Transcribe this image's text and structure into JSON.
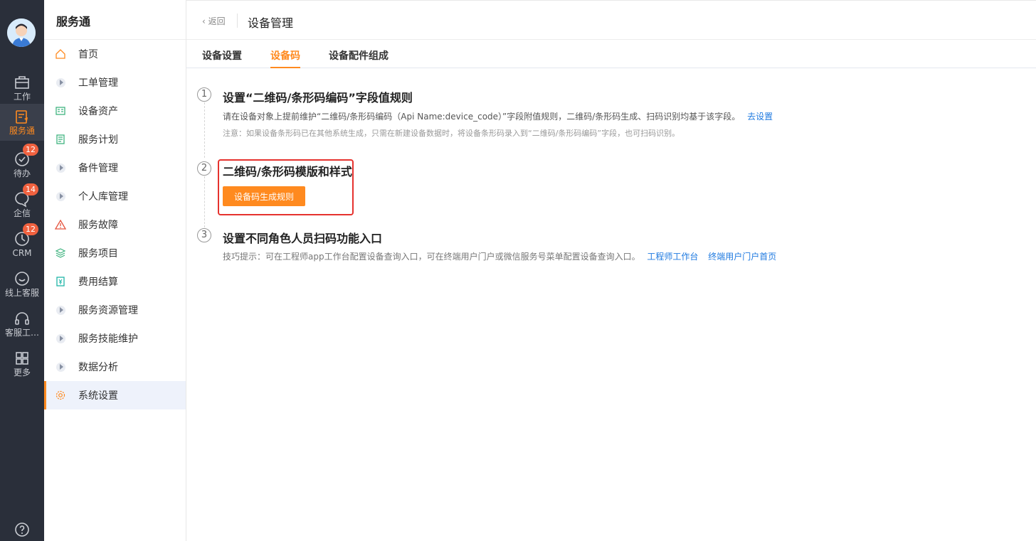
{
  "rail": {
    "items": [
      {
        "label": "工作",
        "icon": "briefcase-icon"
      },
      {
        "label": "服务通",
        "icon": "service-icon",
        "active": true
      },
      {
        "label": "待办",
        "icon": "check-circle-icon",
        "badge": "12"
      },
      {
        "label": "企信",
        "icon": "chat-icon",
        "badge": "14"
      },
      {
        "label": "CRM",
        "icon": "crm-icon",
        "badge": "12"
      },
      {
        "label": "线上客服",
        "icon": "smile-chat-icon"
      },
      {
        "label": "客服工…",
        "icon": "headset-icon"
      },
      {
        "label": "更多",
        "icon": "grid-icon"
      }
    ],
    "help_icon": "help-icon",
    "accent": "#ff8a1f",
    "bg": "#2a2f3a"
  },
  "sidebar": {
    "title": "服务通",
    "items": [
      {
        "label": "首页",
        "icon": "home-icon"
      },
      {
        "label": "工单管理",
        "icon": "expand-icon"
      },
      {
        "label": "设备资产",
        "icon": "asset-icon"
      },
      {
        "label": "服务计划",
        "icon": "plan-icon"
      },
      {
        "label": "备件管理",
        "icon": "expand-icon"
      },
      {
        "label": "个人库管理",
        "icon": "expand-icon"
      },
      {
        "label": "服务故障",
        "icon": "warning-icon"
      },
      {
        "label": "服务项目",
        "icon": "layers-icon"
      },
      {
        "label": "费用结算",
        "icon": "fee-icon"
      },
      {
        "label": "服务资源管理",
        "icon": "expand-icon"
      },
      {
        "label": "服务技能维护",
        "icon": "expand-icon"
      },
      {
        "label": "数据分析",
        "icon": "expand-icon"
      },
      {
        "label": "系统设置",
        "icon": "gear-icon",
        "active": true
      }
    ]
  },
  "header": {
    "back_label": "返回",
    "title": "设备管理"
  },
  "tabs": [
    {
      "label": "设备设置"
    },
    {
      "label": "设备码",
      "active": true
    },
    {
      "label": "设备配件组成"
    }
  ],
  "steps": [
    {
      "num": "1",
      "title": "设置“二维码/条形码编码”字段值规则",
      "desc": "请在设备对象上提前维护“二维码/条形码编码（Api Name:device_code）”字段附值规则，二维码/条形码生成、扫码识别均基于该字段。",
      "link": "去设置",
      "note": "注意：如果设备条形码已在其他系统生成，只需在新建设备数据时，将设备条形码录入到“二维码/条形码编码”字段，也可扫码识别。"
    },
    {
      "num": "2",
      "title": "二维码/条形码模版和样式",
      "button": "设备码生成规则"
    },
    {
      "num": "3",
      "title": "设置不同角色人员扫码功能入口",
      "desc": "技巧提示：可在工程师app工作台配置设备查询入口，可在终端用户门户或微信服务号菜单配置设备查询入口。",
      "links": [
        "工程师工作台",
        "终端用户门户首页"
      ]
    }
  ]
}
